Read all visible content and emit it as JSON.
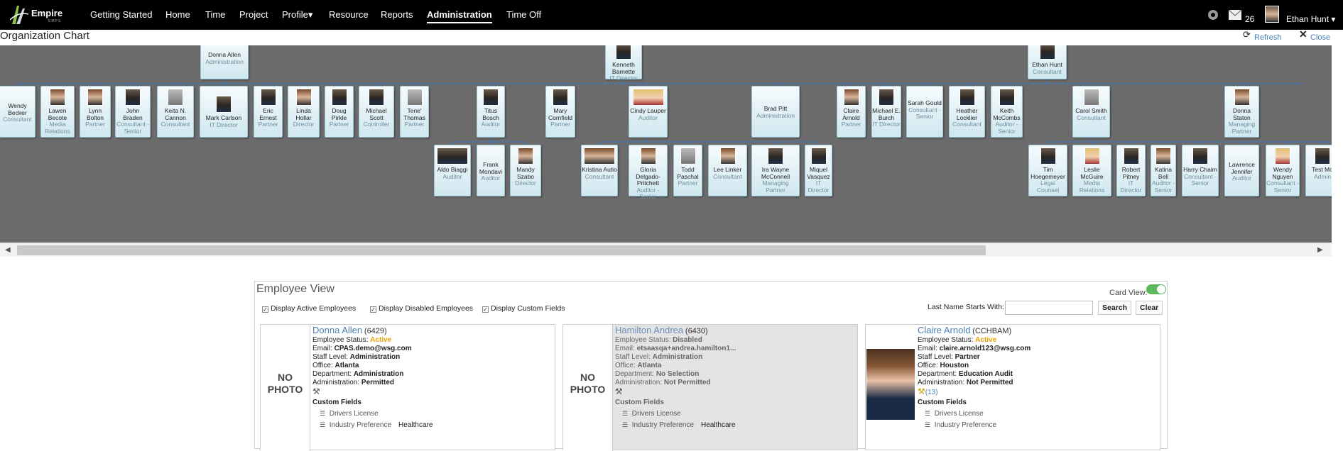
{
  "nav": {
    "logo_word": "Empire",
    "logo_sub": "EMPS",
    "items": [
      {
        "label": "Getting Started"
      },
      {
        "label": "Home"
      },
      {
        "label": "Time"
      },
      {
        "label": "Project"
      },
      {
        "label": "Profile▾"
      },
      {
        "label": "Resource"
      },
      {
        "label": "Reports"
      },
      {
        "label": "Administration",
        "active": true
      },
      {
        "label": "Time Off"
      }
    ],
    "message_count": "26",
    "user_name": "Ethan Hunt ▾"
  },
  "page": {
    "title": "Organization Chart",
    "refresh_label": "Refresh",
    "close_label": "Close"
  },
  "org": {
    "roots": [
      {
        "name": "Donna Allen",
        "role": "Administration"
      },
      {
        "name": "Kenneth Barnette",
        "role": "IT Director"
      },
      {
        "name": "Ethan Hunt",
        "role": "Consultant"
      }
    ],
    "level2": [
      {
        "name": "Wendy Becker",
        "role": "Consultant"
      },
      {
        "name": "Lawen Becote",
        "role": "Media Relations"
      },
      {
        "name": "Lynn Bolton",
        "role": "Partner"
      },
      {
        "name": "John Braden",
        "role": "Consultant - Senior"
      },
      {
        "name": "Keita N. Cannon",
        "role": "Consultant"
      },
      {
        "name": "Mark Carlson",
        "role": "IT Director"
      },
      {
        "name": "Eric Ernest",
        "role": "Partner"
      },
      {
        "name": "Linda Hollar",
        "role": "Director"
      },
      {
        "name": "Doug Pirkle",
        "role": "Partner"
      },
      {
        "name": "Michael Scott",
        "role": "Controller"
      },
      {
        "name": "Tene' Thomas",
        "role": "Partner"
      },
      {
        "name": "Titus Bosch",
        "role": "Auditor"
      },
      {
        "name": "Mary Cornfield",
        "role": "Partner"
      },
      {
        "name": "Cindy Lauper",
        "role": "Auditor"
      },
      {
        "name": "Brad Pitt",
        "role": "Administration"
      },
      {
        "name": "Claire Arnold",
        "role": "Partner"
      },
      {
        "name": "Michael E. Burch",
        "role": "IT Director"
      },
      {
        "name": "Sarah Gould",
        "role": "Consultant - Senior"
      },
      {
        "name": "Heather Locklier",
        "role": "Consultant"
      },
      {
        "name": "Keith McCombs",
        "role": "Auditor - Senior"
      },
      {
        "name": "Carol Smith",
        "role": "Consultant"
      },
      {
        "name": "Donna Staton",
        "role": "Managing Partner"
      }
    ],
    "level3": [
      {
        "name": "Aldo Biaggi",
        "role": "Auditor"
      },
      {
        "name": "Frank Mondavi",
        "role": "Auditor"
      },
      {
        "name": "Mandy Szabo",
        "role": "Director"
      },
      {
        "name": "Kristina Autio",
        "role": "Consultant"
      },
      {
        "name": "Gloria Delgado-Pritchett",
        "role": "Auditor - Senior"
      },
      {
        "name": "Todd Paschal",
        "role": "Partner"
      },
      {
        "name": "Lee Linker",
        "role": "Consultant"
      },
      {
        "name": "Ira Wayne McConnell",
        "role": "Managing Partner"
      },
      {
        "name": "Miquel Vasquez",
        "role": "IT Director"
      },
      {
        "name": "Tim Hoegemeyer",
        "role": "Legal Counsel"
      },
      {
        "name": "Leslie McGuire",
        "role": "Media Relations"
      },
      {
        "name": "Robert Pitney",
        "role": "IT Director"
      },
      {
        "name": "Katina Bell",
        "role": "Auditor - Senior"
      },
      {
        "name": "Harry Chaim",
        "role": "Consultant - Senior"
      },
      {
        "name": "Lawrence Jennifer",
        "role": "Auditor"
      },
      {
        "name": "Wendy Nguyen",
        "role": "Consultant - Senior"
      },
      {
        "name": "Test Mo",
        "role": "Admin"
      }
    ]
  },
  "emp": {
    "title": "Employee View",
    "card_view_label": "Card View:",
    "chk_active": "Display Active Employees",
    "chk_disabled": "Display Disabled Employees",
    "chk_custom": "Display Custom Fields",
    "last_name_label": "Last Name Starts With:",
    "last_name_value": "",
    "search_label": "Search",
    "clear_label": "Clear",
    "no_photo": "NO PHOTO",
    "lbl_status": "Employee Status:",
    "lbl_email": "Email:",
    "lbl_staff": "Staff Level:",
    "lbl_office": "Office:",
    "lbl_dept": "Department:",
    "lbl_admin": "Administration:",
    "lbl_custom": "Custom Fields",
    "lbl_drivers": "Drivers License",
    "lbl_industry": "Industry Preference",
    "cards": [
      {
        "name": "Donna Allen",
        "id": "(6429)",
        "status": "Active",
        "email": "CPAS.demo@wsg.com",
        "staff": "Administration",
        "office": "Atlanta",
        "dept": "Administration",
        "admin": "Permitted",
        "count": "",
        "drivers": "",
        "industry": "Healthcare"
      },
      {
        "name": "Hamilton Andrea",
        "id": "(6430)",
        "status": "Disabled",
        "email": "etsaasqa+andrea.hamilton1...",
        "staff": "Administration",
        "office": "Atlanta",
        "dept": "No Selection",
        "admin": "Not Permitted",
        "count": "",
        "drivers": "",
        "industry": "Healthcare"
      },
      {
        "name": "Claire Arnold",
        "id": "(CCHBAM)",
        "status": "Active",
        "email": "claire.arnold123@wsg.com",
        "staff": "Partner",
        "office": "Houston",
        "dept": "Education Audit",
        "admin": "Not Permitted",
        "count": "(13)",
        "drivers": "",
        "industry": ""
      }
    ]
  }
}
